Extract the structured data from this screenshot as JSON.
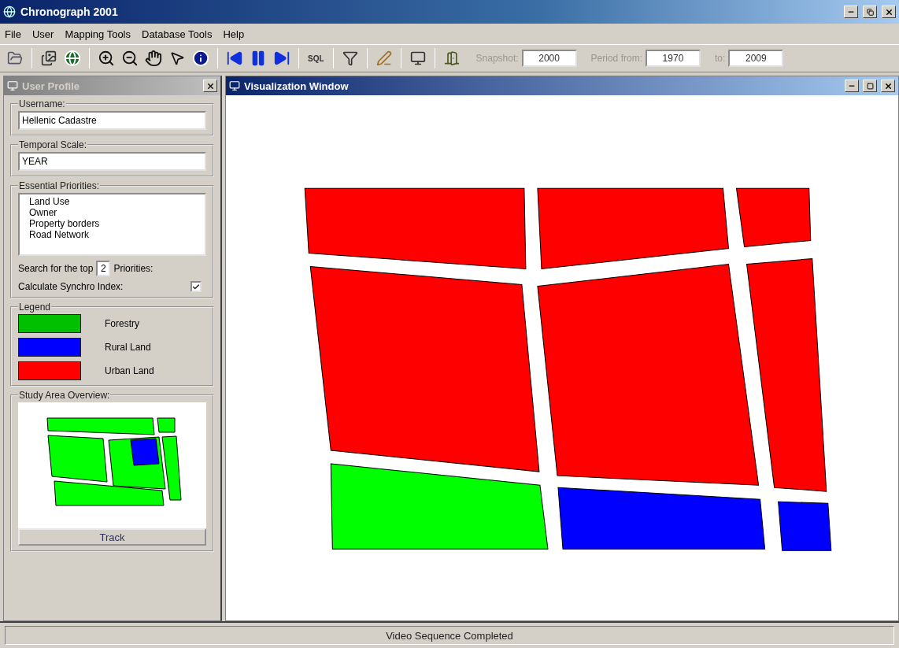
{
  "window": {
    "title": "Chronograph 2001"
  },
  "menu": [
    "File",
    "User",
    "Mapping Tools",
    "Database Tools",
    "Help"
  ],
  "toolbar": {
    "sql_label": "SQL",
    "snapshot": {
      "label": "Snapshot:",
      "value": "2000"
    },
    "period_from": {
      "label": "Period from:",
      "value": "1970"
    },
    "period_to": {
      "label": "to:",
      "value": "2009"
    }
  },
  "user_profile": {
    "title": "User Profile",
    "username": {
      "label": "Username:",
      "value": "Hellenic Cadastre"
    },
    "temporal_scale": {
      "label": "Temporal Scale:",
      "value": "YEAR"
    },
    "priorities": {
      "label": "Essential Priorities:",
      "items": [
        "Land Use",
        "Owner",
        "Property borders",
        "Road Network"
      ]
    },
    "top_search": {
      "before": "Search for the top",
      "value": "2",
      "after": "Priorities:"
    },
    "synchro": {
      "label": "Calculate Synchro Index:",
      "checked": true
    },
    "legend": {
      "label": "Legend",
      "items": [
        {
          "label": "Forestry",
          "color": "#00c000"
        },
        {
          "label": "Rural Land",
          "color": "#0000ff"
        },
        {
          "label": "Urban Land",
          "color": "#ff0000"
        }
      ]
    },
    "overview": {
      "label": "Study Area Overview:",
      "button": "Track"
    }
  },
  "visualization": {
    "title": "Visualization Window",
    "parcels": [
      {
        "color": "#ff0000"
      },
      {
        "color": "#ff0000"
      },
      {
        "color": "#ff0000"
      },
      {
        "color": "#ff0000"
      },
      {
        "color": "#ff0000"
      },
      {
        "color": "#ff0000"
      },
      {
        "color": "#00ff00"
      },
      {
        "color": "#0000ff"
      },
      {
        "color": "#0000ff"
      }
    ]
  },
  "status_bar": "Video Sequence Completed"
}
